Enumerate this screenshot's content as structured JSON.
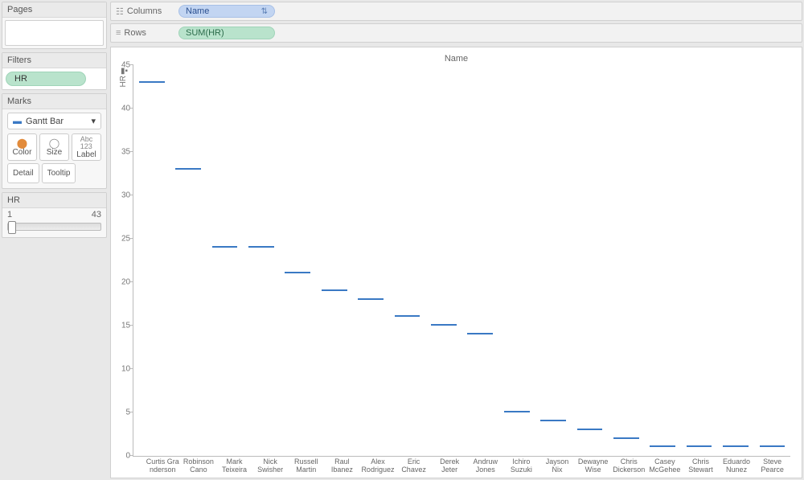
{
  "sidebar": {
    "pages_header": "Pages",
    "filters_header": "Filters",
    "filter_pill": "HR",
    "marks_header": "Marks",
    "marks_type": "Gantt Bar",
    "mark_buttons": {
      "color": "Color",
      "size": "Size",
      "label": "Label",
      "detail": "Detail",
      "tooltip": "Tooltip"
    },
    "hr_header": "HR",
    "hr_min": "1",
    "hr_max": "43"
  },
  "shelves": {
    "columns_label": "Columns",
    "rows_label": "Rows",
    "columns_pill": "Name",
    "rows_pill": "SUM(HR)"
  },
  "viz": {
    "title": "Name",
    "yaxis_title": "HR"
  },
  "chart_data": {
    "type": "bar",
    "mark": "gantt",
    "title": "Name",
    "xlabel": "Name",
    "ylabel": "HR",
    "ylim": [
      0,
      45
    ],
    "yticks": [
      0,
      5,
      10,
      15,
      20,
      25,
      30,
      35,
      40,
      45
    ],
    "categories": [
      "Curtis Granderson",
      "Robinson Cano",
      "Mark Teixeira",
      "Nick Swisher",
      "Russell Martin",
      "Raul Ibanez",
      "Alex Rodriguez",
      "Eric Chavez",
      "Derek Jeter",
      "Andruw Jones",
      "Ichiro Suzuki",
      "Jayson Nix",
      "Dewayne Wise",
      "Chris Dickerson",
      "Casey McGehee",
      "Chris Stewart",
      "Eduardo Nunez",
      "Steve Pearce"
    ],
    "categories_display": [
      "Curtis Gra\nnderson",
      "Robinson\nCano",
      "Mark\nTeixeira",
      "Nick\nSwisher",
      "Russell\nMartin",
      "Raul\nIbanez",
      "Alex\nRodriguez",
      "Eric\nChavez",
      "Derek\nJeter",
      "Andruw\nJones",
      "Ichiro\nSuzuki",
      "Jayson Nix",
      "Dewayne\nWise",
      "Chris\nDickerson",
      "Casey\nMcGehee",
      "Chris\nStewart",
      "Eduardo\nNunez",
      "Steve\nPearce"
    ],
    "values": [
      43,
      33,
      24,
      24,
      21,
      19,
      18,
      16,
      15,
      14,
      5,
      4,
      3,
      2,
      1,
      1,
      1,
      1
    ]
  }
}
